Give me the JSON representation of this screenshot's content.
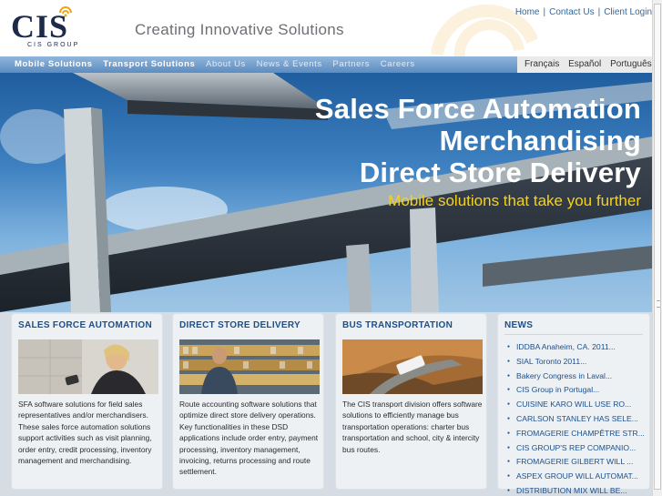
{
  "brand": {
    "logo_text": "CIS",
    "logo_sub": "CIS GROUP",
    "tagline": "Creating Innovative Solutions"
  },
  "top_links": [
    "Home",
    "Contact Us",
    "Client Login"
  ],
  "nav": {
    "items": [
      "Mobile Solutions",
      "Transport Solutions",
      "About Us",
      "News & Events",
      "Partners",
      "Careers"
    ]
  },
  "languages": [
    "Français",
    "Español",
    "Português"
  ],
  "hero": {
    "lines": [
      "Sales Force Automation",
      "Merchandising",
      "Direct Store Delivery"
    ],
    "subtitle": "Mobile solutions that take you further"
  },
  "panels": [
    {
      "title": "SALES FORCE AUTOMATION",
      "text": "SFA software solutions for field sales representatives and/or merchandisers. These sales force automation solutions support activities such as visit planning, order entry, credit processing, inventory management and merchandising."
    },
    {
      "title": "DIRECT STORE DELIVERY",
      "text": "Route accounting software solutions that optimize direct store delivery operations. Key functionalities in these DSD applications include order entry, payment processing, inventory management, invoicing, returns processing and route settlement."
    },
    {
      "title": "BUS TRANSPORTATION",
      "text": "The CIS transport division offers software solutions to efficiently manage bus transportation operations: charter bus transportation and school, city & intercity bus routes."
    }
  ],
  "news": {
    "title": "NEWS",
    "items": [
      "IDDBA Anaheim, CA. 2011...",
      "SIAL Toronto 2011...",
      "Bakery Congress in Laval...",
      "CIS Group in Portugal...",
      "CUISINE KARO WILL USE RO...",
      "CARLSON STANLEY HAS SELE...",
      "FROMAGERIE CHAMPÊTRE STR...",
      "CIS GROUP'S REP COMPANIO...",
      "FROMAGERIE GILBERT WILL ...",
      "ASPEX GROUP WILL AUTOMAT...",
      "DISTRIBUTION MIX WILL BE..."
    ]
  },
  "colors": {
    "nav_blue": "#6b97c9",
    "link_blue": "#2c6aa8",
    "title_blue": "#1b4f8c",
    "hero_yellow": "#f4d21e",
    "logo_navy": "#1d2a4a",
    "logo_orange": "#f0a51a"
  }
}
